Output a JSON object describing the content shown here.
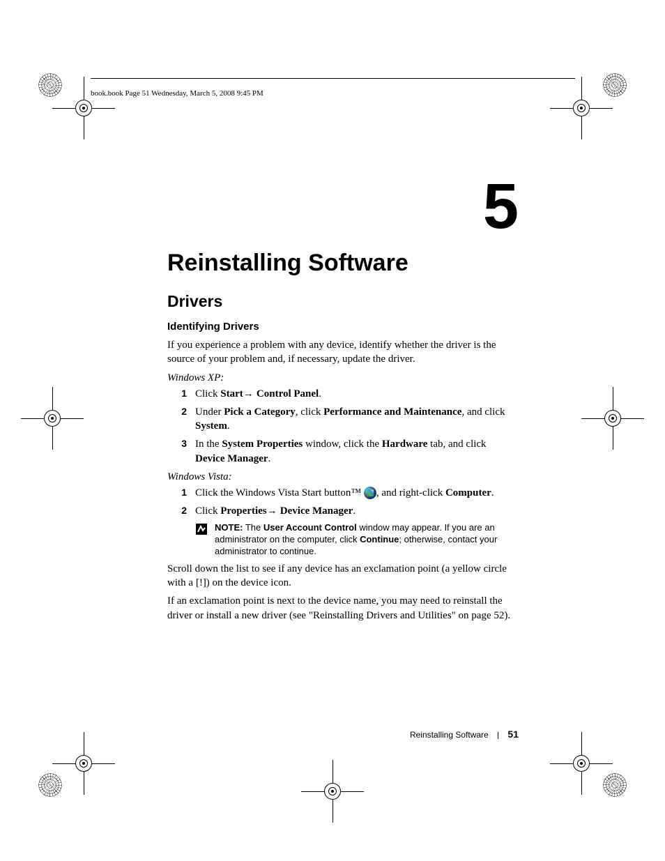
{
  "header": {
    "running_head": "book.book  Page 51  Wednesday, March 5, 2008  9:45 PM"
  },
  "chapter": {
    "number": "5",
    "title": "Reinstalling Software"
  },
  "section": {
    "title": "Drivers"
  },
  "subsection": {
    "title": "Identifying Drivers"
  },
  "intro_para": "If you experience a problem with any device, identify whether the driver is the source of your problem and, if necessary, update the driver.",
  "xp": {
    "label": "Windows XP:",
    "step1_a": "Click ",
    "step1_b": "Start",
    "step1_c": "→ ",
    "step1_d": "Control Panel",
    "step1_e": ".",
    "step2_a": "Under ",
    "step2_b": "Pick a Category",
    "step2_c": ", click ",
    "step2_d": "Performance and Maintenance",
    "step2_e": ", and click ",
    "step2_f": "System",
    "step2_g": ".",
    "step3_a": "In the ",
    "step3_b": "System Properties",
    "step3_c": " window, click the ",
    "step3_d": "Hardware",
    "step3_e": " tab, and click ",
    "step3_f": "Device Manager",
    "step3_g": "."
  },
  "vista": {
    "label": "Windows Vista:",
    "step1_a": "Click the Windows Vista Start button™ ",
    "step1_b": ", and right-click ",
    "step1_c": "Computer",
    "step1_d": ".",
    "step2_a": "Click ",
    "step2_b": "Properties",
    "step2_c": "→ ",
    "step2_d": "Device Manager",
    "step2_e": "."
  },
  "note": {
    "label": "NOTE:",
    "t1": " The ",
    "b1": "User Account Control",
    "t2": " window may appear. If you are an administrator on the computer, click ",
    "b2": "Continue",
    "t3": "; otherwise, contact your administrator to continue."
  },
  "after1": "Scroll down the list to see if any device has an exclamation point (a yellow circle with a [!]) on the device icon.",
  "after2": "If an exclamation point is next to the device name, you may need to reinstall the driver or install a new driver (see \"Reinstalling Drivers and Utilities\" on page 52).",
  "footer": {
    "section": "Reinstalling Software",
    "page": "51"
  }
}
